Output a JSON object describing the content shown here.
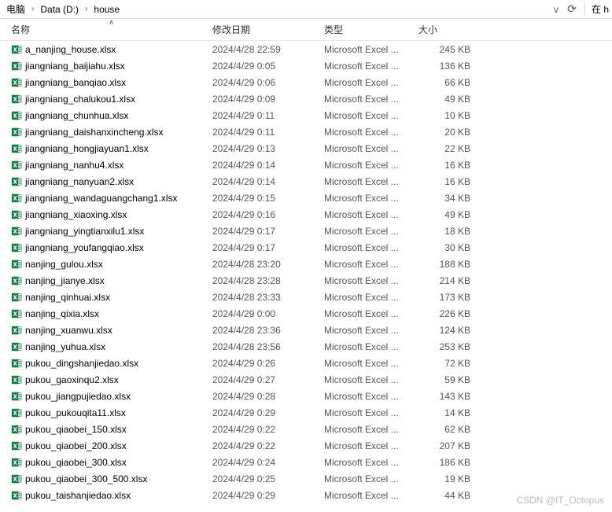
{
  "breadcrumb": {
    "items": [
      "电脑",
      "Data (D:)",
      "house"
    ],
    "dropdown_icon": "v",
    "refresh_icon": "⟳",
    "right_text": "在 h"
  },
  "columns": {
    "name": "名称",
    "date": "修改日期",
    "type": "类型",
    "size": "大小",
    "sort_indicator": "∧"
  },
  "file_type_label": "Microsoft Excel ...",
  "size_unit": "KB",
  "files": [
    {
      "name": "a_nanjing_house.xlsx",
      "date": "2024/4/28 22:59",
      "size": "245"
    },
    {
      "name": "jiangniang_baijiahu.xlsx",
      "date": "2024/4/29 0:05",
      "size": "136"
    },
    {
      "name": "jiangniang_banqiao.xlsx",
      "date": "2024/4/29 0:06",
      "size": "66"
    },
    {
      "name": "jiangniang_chalukou1.xlsx",
      "date": "2024/4/29 0:09",
      "size": "49"
    },
    {
      "name": "jiangniang_chunhua.xlsx",
      "date": "2024/4/29 0:11",
      "size": "10"
    },
    {
      "name": "jiangniang_daishanxincheng.xlsx",
      "date": "2024/4/29 0:11",
      "size": "20"
    },
    {
      "name": "jiangniang_hongjiayuan1.xlsx",
      "date": "2024/4/29 0:13",
      "size": "22"
    },
    {
      "name": "jiangniang_nanhu4.xlsx",
      "date": "2024/4/29 0:14",
      "size": "16"
    },
    {
      "name": "jiangniang_nanyuan2.xlsx",
      "date": "2024/4/29 0:14",
      "size": "16"
    },
    {
      "name": "jiangniang_wandaguangchang1.xlsx",
      "date": "2024/4/29 0:15",
      "size": "34"
    },
    {
      "name": "jiangniang_xiaoxing.xlsx",
      "date": "2024/4/29 0:16",
      "size": "49"
    },
    {
      "name": "jiangniang_yingtianxilu1.xlsx",
      "date": "2024/4/29 0:17",
      "size": "18"
    },
    {
      "name": "jiangniang_youfangqiao.xlsx",
      "date": "2024/4/29 0:17",
      "size": "30"
    },
    {
      "name": "nanjing_gulou.xlsx",
      "date": "2024/4/28 23:20",
      "size": "188"
    },
    {
      "name": "nanjing_jianye.xlsx",
      "date": "2024/4/28 23:28",
      "size": "214"
    },
    {
      "name": "nanjing_qinhuai.xlsx",
      "date": "2024/4/28 23:33",
      "size": "173"
    },
    {
      "name": "nanjing_qixia.xlsx",
      "date": "2024/4/29 0:00",
      "size": "226"
    },
    {
      "name": "nanjing_xuanwu.xlsx",
      "date": "2024/4/28 23:36",
      "size": "124"
    },
    {
      "name": "nanjing_yuhua.xlsx",
      "date": "2024/4/28 23:56",
      "size": "253"
    },
    {
      "name": "pukou_dingshanjiedao.xlsx",
      "date": "2024/4/29 0:26",
      "size": "72"
    },
    {
      "name": "pukou_gaoxinqu2.xlsx",
      "date": "2024/4/29 0:27",
      "size": "59"
    },
    {
      "name": "pukou_jiangpujiedao.xlsx",
      "date": "2024/4/29 0:28",
      "size": "143"
    },
    {
      "name": "pukou_pukouqita11.xlsx",
      "date": "2024/4/29 0:29",
      "size": "14"
    },
    {
      "name": "pukou_qiaobei_150.xlsx",
      "date": "2024/4/29 0:22",
      "size": "62"
    },
    {
      "name": "pukou_qiaobei_200.xlsx",
      "date": "2024/4/29 0:22",
      "size": "207"
    },
    {
      "name": "pukou_qiaobei_300.xlsx",
      "date": "2024/4/29 0:24",
      "size": "186"
    },
    {
      "name": "pukou_qiaobei_300_500.xlsx",
      "date": "2024/4/29 0:25",
      "size": "19"
    },
    {
      "name": "pukou_taishanjiedao.xlsx",
      "date": "2024/4/29 0:29",
      "size": "44"
    }
  ],
  "watermark": "CSDN @IT_Octopus"
}
